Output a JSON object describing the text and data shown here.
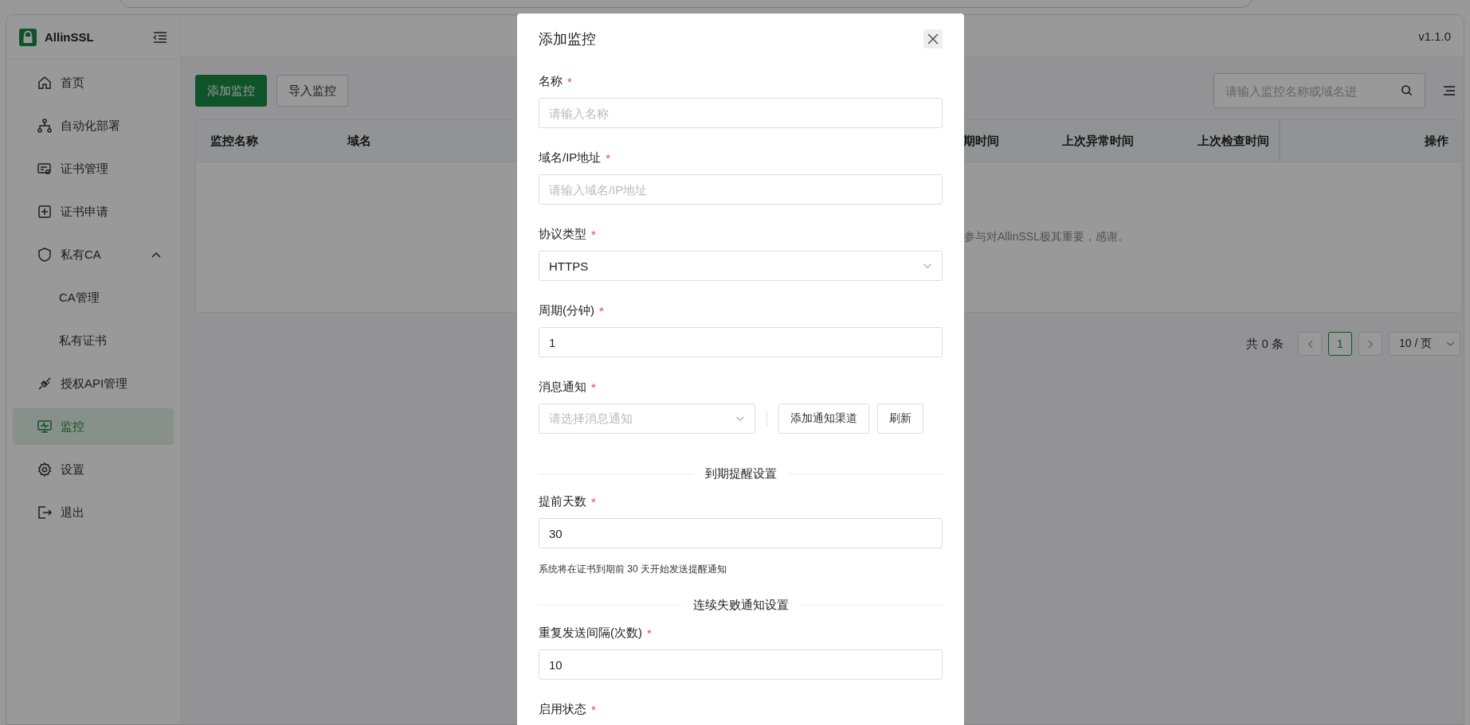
{
  "sidebar": {
    "brand": "AllinSSL",
    "items": [
      {
        "label": "首页",
        "selected": false
      },
      {
        "label": "自动化部署",
        "selected": false
      },
      {
        "label": "证书管理",
        "selected": false
      },
      {
        "label": "证书申请",
        "selected": false
      },
      {
        "label": "私有CA",
        "selected": false,
        "expanded": true,
        "children": [
          {
            "label": "CA管理",
            "selected": false
          },
          {
            "label": "私有证书",
            "selected": false
          }
        ]
      },
      {
        "label": "授权API管理",
        "selected": false
      },
      {
        "label": "监控",
        "selected": true
      },
      {
        "label": "设置",
        "selected": false
      },
      {
        "label": "退出",
        "selected": false
      }
    ]
  },
  "header": {
    "version": "v1.1.0"
  },
  "toolbar": {
    "buttons": [
      {
        "label": "添加监控",
        "kind": "primary"
      },
      {
        "label": "导入监控",
        "kind": "default"
      }
    ],
    "search": {
      "placeholder": "请输入监控名称或域名进"
    }
  },
  "table": {
    "columns": [
      {
        "label": "监控名称"
      },
      {
        "label": "域名"
      },
      {
        "label": "期时间"
      },
      {
        "label": "上次异常时间"
      },
      {
        "label": "上次检查时间"
      },
      {
        "label": "操作"
      }
    ],
    "empty_text": "参与对AllinSSL极其重要，感谢。"
  },
  "pagination": {
    "total": "共 0 条",
    "pages": [
      {
        "label": "1",
        "selected": true
      }
    ],
    "page_size": "10 / 页"
  },
  "dialog": {
    "title": "添加监控",
    "fields": [
      {
        "kind": "input",
        "label": "名称",
        "mark": "*",
        "placeholder": "请输入名称"
      },
      {
        "kind": "input",
        "label": "域名/IP地址",
        "mark": "*",
        "placeholder": "请输入域名/IP地址"
      },
      {
        "kind": "select",
        "label": "协议类型",
        "mark": "*",
        "value": "HTTPS"
      },
      {
        "kind": "input",
        "label": "周期(分钟)",
        "mark": "*",
        "value": "1"
      },
      {
        "kind": "notify",
        "label": "消息通知",
        "mark": "*",
        "placeholder": "请选择消息通知",
        "buttons": [
          "添加通知渠道",
          "刷新"
        ]
      },
      {
        "kind": "section",
        "label": "到期提醒设置"
      },
      {
        "kind": "input",
        "label": "提前天数",
        "mark": "*",
        "value": "30",
        "help": "系统将在证书到期前 30 天开始发送提醒通知"
      },
      {
        "kind": "section",
        "label": "连续失败通知设置"
      },
      {
        "kind": "input",
        "label": "重复发送间隔(次数)",
        "mark": "*",
        "value": "10"
      },
      {
        "kind": "label",
        "label": "启用状态",
        "mark": "*"
      }
    ]
  }
}
